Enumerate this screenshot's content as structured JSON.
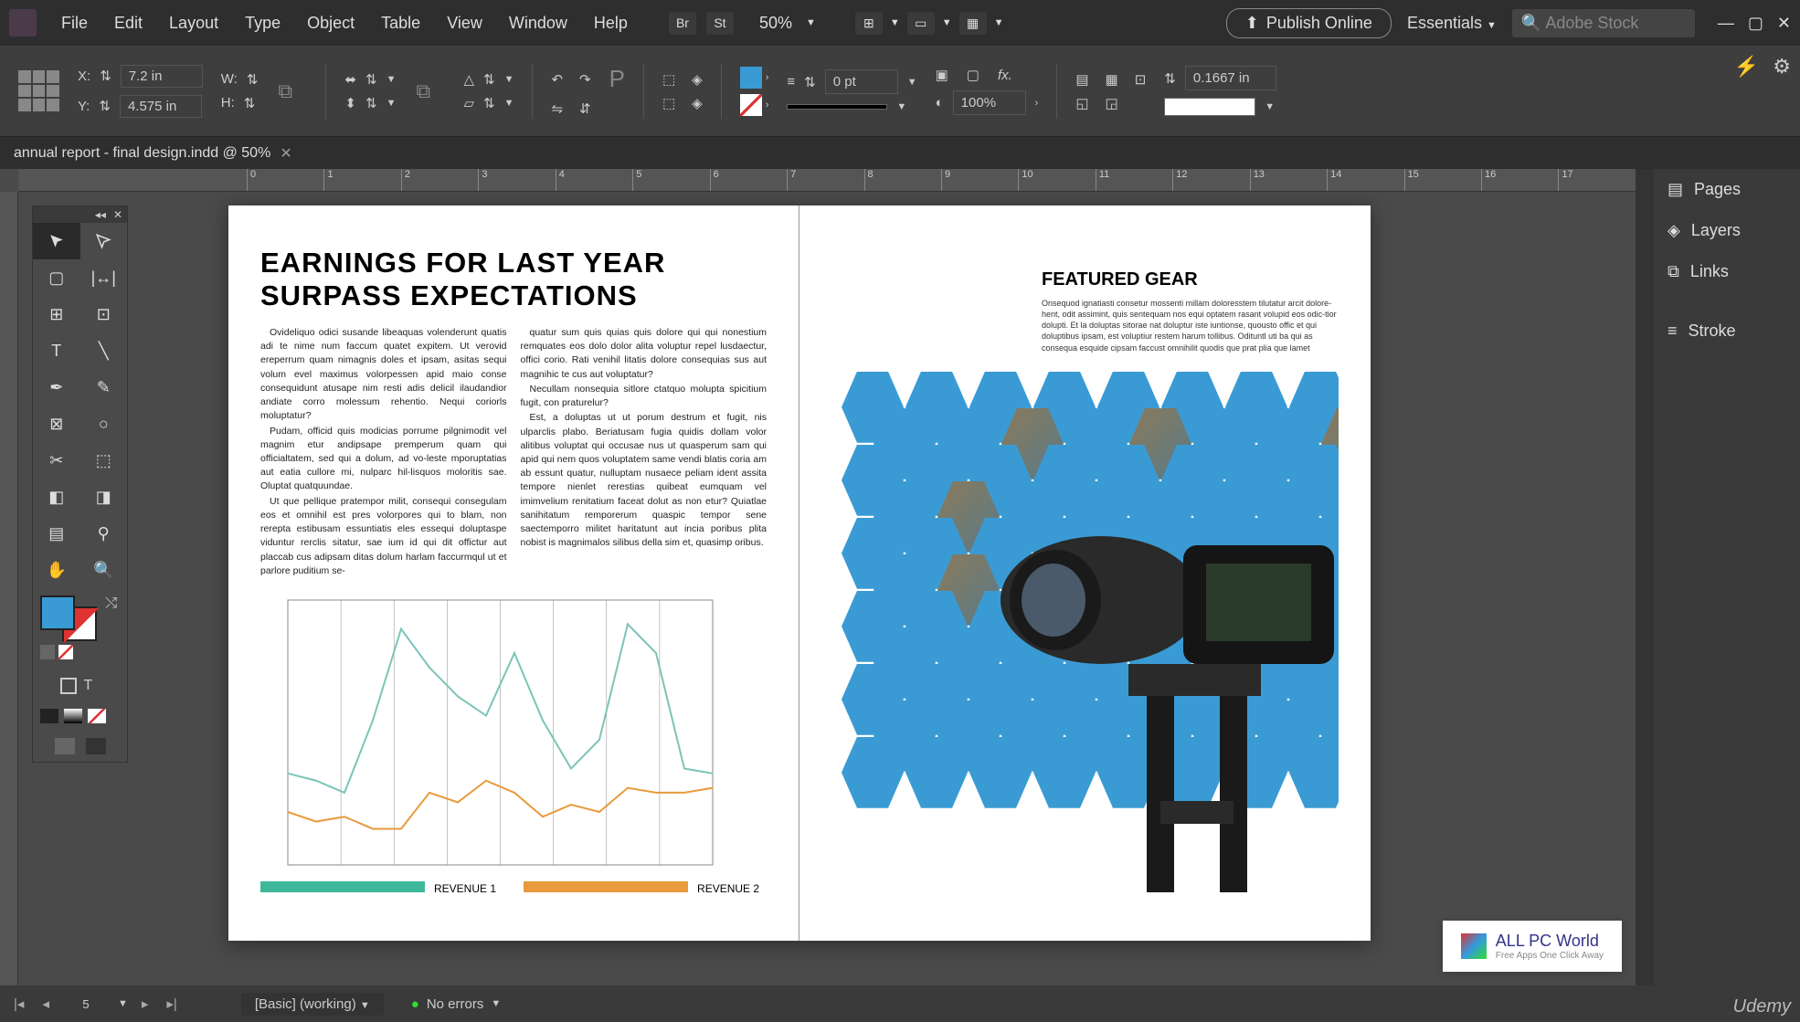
{
  "menu": {
    "items": [
      "File",
      "Edit",
      "Layout",
      "Type",
      "Object",
      "Table",
      "View",
      "Window",
      "Help"
    ]
  },
  "zoom": "50%",
  "publish": "Publish Online",
  "workspace_name": "Essentials",
  "search_placeholder": "Adobe Stock",
  "coords": {
    "x_label": "X:",
    "x": "7.2 in",
    "y_label": "Y:",
    "y": "4.575 in",
    "w_label": "W:",
    "h_label": "H:"
  },
  "control": {
    "pt": "0 pt",
    "scale": "100%",
    "frame": "0.1667 in"
  },
  "tab": {
    "title": "annual report - final design.indd @ 50%"
  },
  "document": {
    "headline": "EARNINGS FOR LAST YEAR SURPASS EXPECTATIONS",
    "body_col1_p1": "Ovideliquo odici susande libeaquas volenderunt quatis adi te nime num faccum quatet expitem. Ut verovid ereperrum quam nimagnis doles et ipsam, asitas sequi volum evel maximus volorpessen apid maio conse consequidunt atusape nim resti adis delicil ilaudandior andiate corro molessum rehentio. Nequi coriorls moluptatur?",
    "body_col1_p2": "Pudam, officid quis modicias porrume pilgnimodit vel magnim etur andipsape premperum quam qui officialtatem, sed qui a dolum, ad vo-leste mporuptatias aut eatia cullore mi, nulparc hil-lisquos moloritis sae. Oluptat quatquundae.",
    "body_col1_p3": "Ut que pellique pratempor milit, consequi consegulam eos et omnihil est pres volorpores qui to blam, non rerepta estibusam essuntiatis eles essequi doluptaspe viduntur rerclis sitatur, sae ium id qui dit offictur aut placcab cus adipsam ditas dolum harlam faccurmqul ut et parlore puditium se-",
    "body_col2_p1": "quatur sum quis quias quis dolore qui qui nonestium remquates eos dolo dolor alita voluptur repel lusdaectur, offici corio. Rati venihil litatis dolore consequias sus aut magnihic te cus aut voluptatur?",
    "body_col2_p2": "Necullam nonsequia sitlore ctatquo molupta spicitium fugit, con praturelur?",
    "body_col2_p3": "Est, a doluptas ut ut porum destrum et fugit, nis ulparclis plabo. Beriatusam fugia quidis dollam volor alitibus voluptat qui occusae nus ut quasperum sam qui apid qui nem quos voluptatem same vendi blatis coria am ab essunt quatur, nulluptam nusaece peliam ident assita tempore nienlet rerestias quibeat eumquam vel imimvelium renitatium faceat dolut as non etur? Quiatlae sanihitatum remporerum quaspic tempor sene saectemporro militet haritatunt aut incia poribus plita nobist is magnimalos silibus della sim et, quasimp oribus.",
    "featured_title": "FEATURED GEAR",
    "featured_text": "Onsequod ignatiasti consetur mossenti millam doloresstem tilutatur arcit dolore-hent, odit assimint, quis sentequam nos equi optatem rasant volupid eos odic-tior dolupti. Et la doluptas sitorae nat doluptur iste iuntionse, quousto offic et qui doluptibus ipsam, est voluptiur restem harum tollibus. Odituntl uti ba qui as consequa esquide cipsam faccust omnihilit quodis que prat plia que lamet",
    "legend1": "REVENUE 1",
    "legend2": "REVENUE 2"
  },
  "chart_data": {
    "type": "line",
    "series": [
      {
        "name": "REVENUE 1",
        "color": "#7bc4b8",
        "values": [
          38,
          35,
          30,
          60,
          98,
          82,
          70,
          62,
          88,
          60,
          40,
          52,
          100,
          88,
          40,
          38
        ]
      },
      {
        "name": "REVENUE 2",
        "color": "#e89a3c",
        "values": [
          22,
          18,
          20,
          15,
          15,
          30,
          26,
          35,
          30,
          20,
          25,
          22,
          32,
          30,
          30,
          32
        ]
      }
    ],
    "xlim": [
      0,
      15
    ],
    "ylim": [
      0,
      110
    ]
  },
  "panels": [
    "Pages",
    "Layers",
    "Links",
    "Stroke"
  ],
  "bottom": {
    "page": "5",
    "preflight": "[Basic] (working)",
    "errors": "No errors"
  },
  "watermark": {
    "title": "ALL PC World",
    "sub": "Free Apps One Click Away"
  },
  "udemy": "Udemy"
}
